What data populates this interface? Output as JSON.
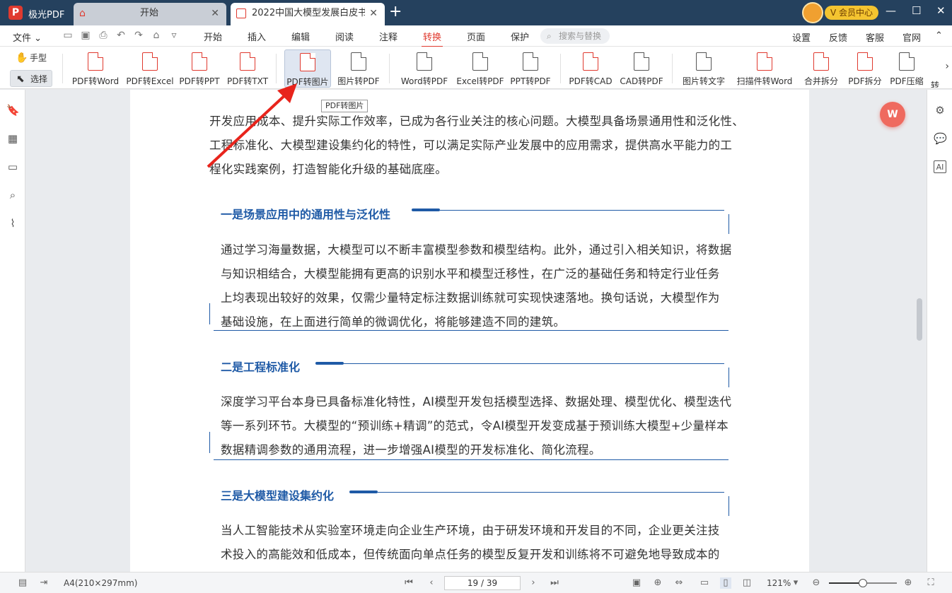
{
  "titlebar": {
    "app_name": "极光PDF",
    "tabs": [
      {
        "label": "开始"
      },
      {
        "label": "2022中国大模型发展白皮书..."
      }
    ],
    "vip_label": "会员中心"
  },
  "menubar": {
    "file_label": "文件",
    "tabs": [
      "开始",
      "插入",
      "编辑",
      "阅读",
      "注释",
      "转换",
      "页面",
      "保护"
    ],
    "active_tab": "转换",
    "search_placeholder": "搜索与替换",
    "right_items": [
      "设置",
      "反馈",
      "客服",
      "官网"
    ]
  },
  "ribbon": {
    "modes": {
      "hand": "手型",
      "select": "选择"
    },
    "items": [
      {
        "label": "PDF转Word",
        "letter": "W"
      },
      {
        "label": "PDF转Excel",
        "letter": "E"
      },
      {
        "label": "PDF转PPT",
        "letter": "P"
      },
      {
        "label": "PDF转TXT",
        "letter": "T"
      },
      {
        "label": "PDF转图片",
        "letter": "▲"
      },
      {
        "label": "图片转PDF",
        "letter": "▲"
      },
      {
        "label": "Word转PDF",
        "letter": "W"
      },
      {
        "label": "Excel转PDF",
        "letter": "E"
      },
      {
        "label": "PPT转PDF",
        "letter": "P"
      },
      {
        "label": "PDF转CAD",
        "letter": "C"
      },
      {
        "label": "CAD转PDF",
        "letter": "C"
      },
      {
        "label": "图片转文字",
        "letter": "T"
      },
      {
        "label": "扫描件转Word",
        "letter": "W"
      },
      {
        "label": "合并拆分",
        "letter": ""
      },
      {
        "label": "PDF拆分",
        "letter": ""
      },
      {
        "label": "PDF压缩",
        "letter": ""
      },
      {
        "label": "转",
        "letter": ""
      }
    ],
    "tooltip": "PDF转图片"
  },
  "document": {
    "intro": [
      "开发应用成本、提升实际工作效率，已成为各行业关注的核心问题。大模型具备场景通用性和泛化性、",
      "工程标准化、大模型建设集约化的特性，可以满足实际产业发展中的应用需求，提供高水平能力的工",
      "程化实践案例，打造智能化升级的基础底座。"
    ],
    "sections": [
      {
        "title": "一是场景应用中的通用性与泛化性",
        "lines": [
          "通过学习海量数据，大模型可以不断丰富模型参数和模型结构。此外，通过引入相关知识，将数据",
          "与知识相结合，大模型能拥有更高的识别水平和模型迁移性，在广泛的基础任务和特定行业任务",
          "上均表现出较好的效果，仅需少量特定标注数据训练就可实现快速落地。换句话说，大模型作为",
          "基础设施，在上面进行简单的微调优化，将能够建造不同的建筑。"
        ]
      },
      {
        "title": "二是工程标准化",
        "lines": [
          "深度学习平台本身已具备标准化特性，AI模型开发包括模型选择、数据处理、模型优化、模型迭代",
          "等一系列环节。大模型的“预训练+精调”的范式，令AI模型开发变成基于预训练大模型+少量样本",
          "数据精调参数的通用流程，进一步增强AI模型的开发标准化、简化流程。"
        ]
      },
      {
        "title": "三是大模型建设集约化",
        "lines": [
          "当人工智能技术从实验室环境走向企业生产环境，由于研发环境和开发目的不同，企业更关注技",
          "术投入的高能效和低成本，但传统面向单点任务的模型反复开发和训练将不可避免地导致成本的"
        ]
      }
    ]
  },
  "statusbar": {
    "page_size": "A4(210×297mm)",
    "page_indicator": "19 / 39",
    "zoom": "121%",
    "zoom_level": 0.5
  },
  "colors": {
    "accent": "#e03a2f",
    "titlebar": "#25415e",
    "heading": "#1f5aa6"
  }
}
